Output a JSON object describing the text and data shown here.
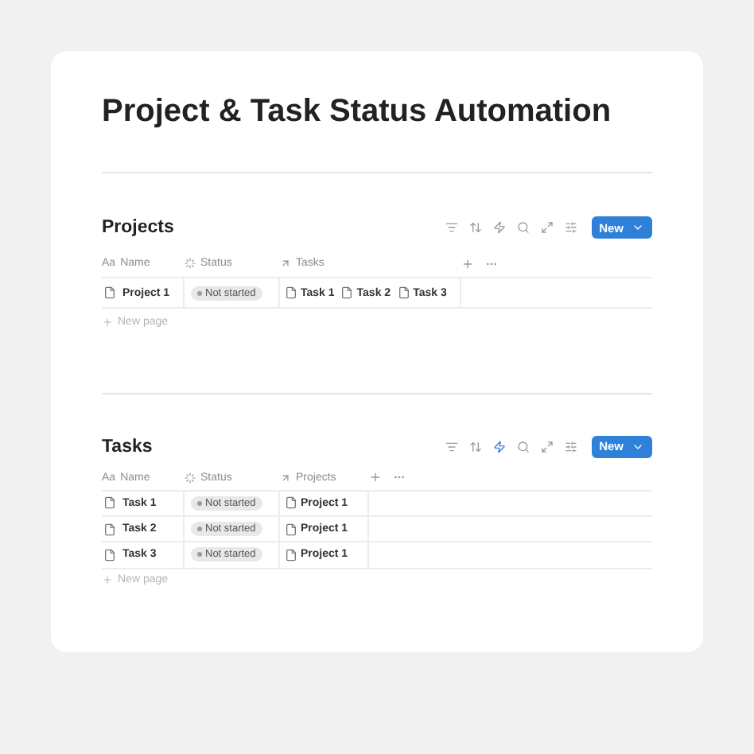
{
  "title": "Project & Task Status Automation",
  "databases": [
    {
      "title": "Projects",
      "automation_active": false,
      "new_button": "New",
      "columns": [
        {
          "kind": "title",
          "glyph": "Aa",
          "label": "Name"
        },
        {
          "kind": "status",
          "label": "Status"
        },
        {
          "kind": "relation",
          "label": "Tasks"
        }
      ],
      "rows": [
        {
          "name": "Project 1",
          "status": "Not started",
          "relations": [
            "Task 1",
            "Task 2",
            "Task 3"
          ]
        }
      ],
      "new_page": "New page"
    },
    {
      "title": "Tasks",
      "automation_active": true,
      "new_button": "New",
      "columns": [
        {
          "kind": "title",
          "glyph": "Aa",
          "label": "Name"
        },
        {
          "kind": "status",
          "label": "Status"
        },
        {
          "kind": "relation",
          "label": "Projects"
        }
      ],
      "rows": [
        {
          "name": "Task 1",
          "status": "Not started",
          "relations": [
            "Project 1"
          ]
        },
        {
          "name": "Task 2",
          "status": "Not started",
          "relations": [
            "Project 1"
          ]
        },
        {
          "name": "Task 3",
          "status": "Not started",
          "relations": [
            "Project 1"
          ]
        }
      ],
      "new_page": "New page"
    }
  ]
}
